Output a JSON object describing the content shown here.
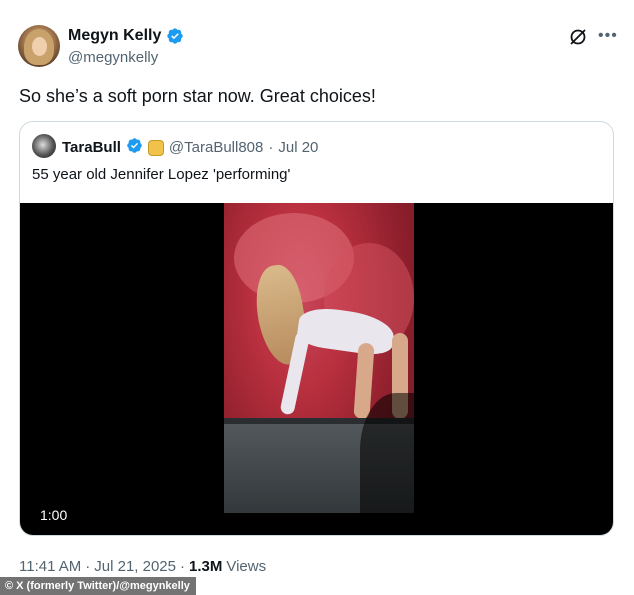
{
  "author": {
    "display_name": "Megyn Kelly",
    "handle": "@megynkelly",
    "verified_icon": "verified-badge-icon"
  },
  "tweet": {
    "text": "So she’s a soft porn star now. Great choices!"
  },
  "quoted": {
    "display_name": "TaraBull",
    "handle": "@TaraBull808",
    "separator": "·",
    "date": "Jul 20",
    "text": "55 year old Jennifer Lopez 'performing'",
    "video_duration": "1:00"
  },
  "meta": {
    "time": "11:41 AM",
    "separator": "·",
    "date": "Jul 21, 2025",
    "separator2": "·",
    "views_count": "1.3M",
    "views_label": "Views"
  },
  "credit": "© X (formerly Twitter)/@megynkelly",
  "colors": {
    "verified": "#1d9bf0",
    "secondary_text": "#536471",
    "border": "#cfd9de"
  }
}
